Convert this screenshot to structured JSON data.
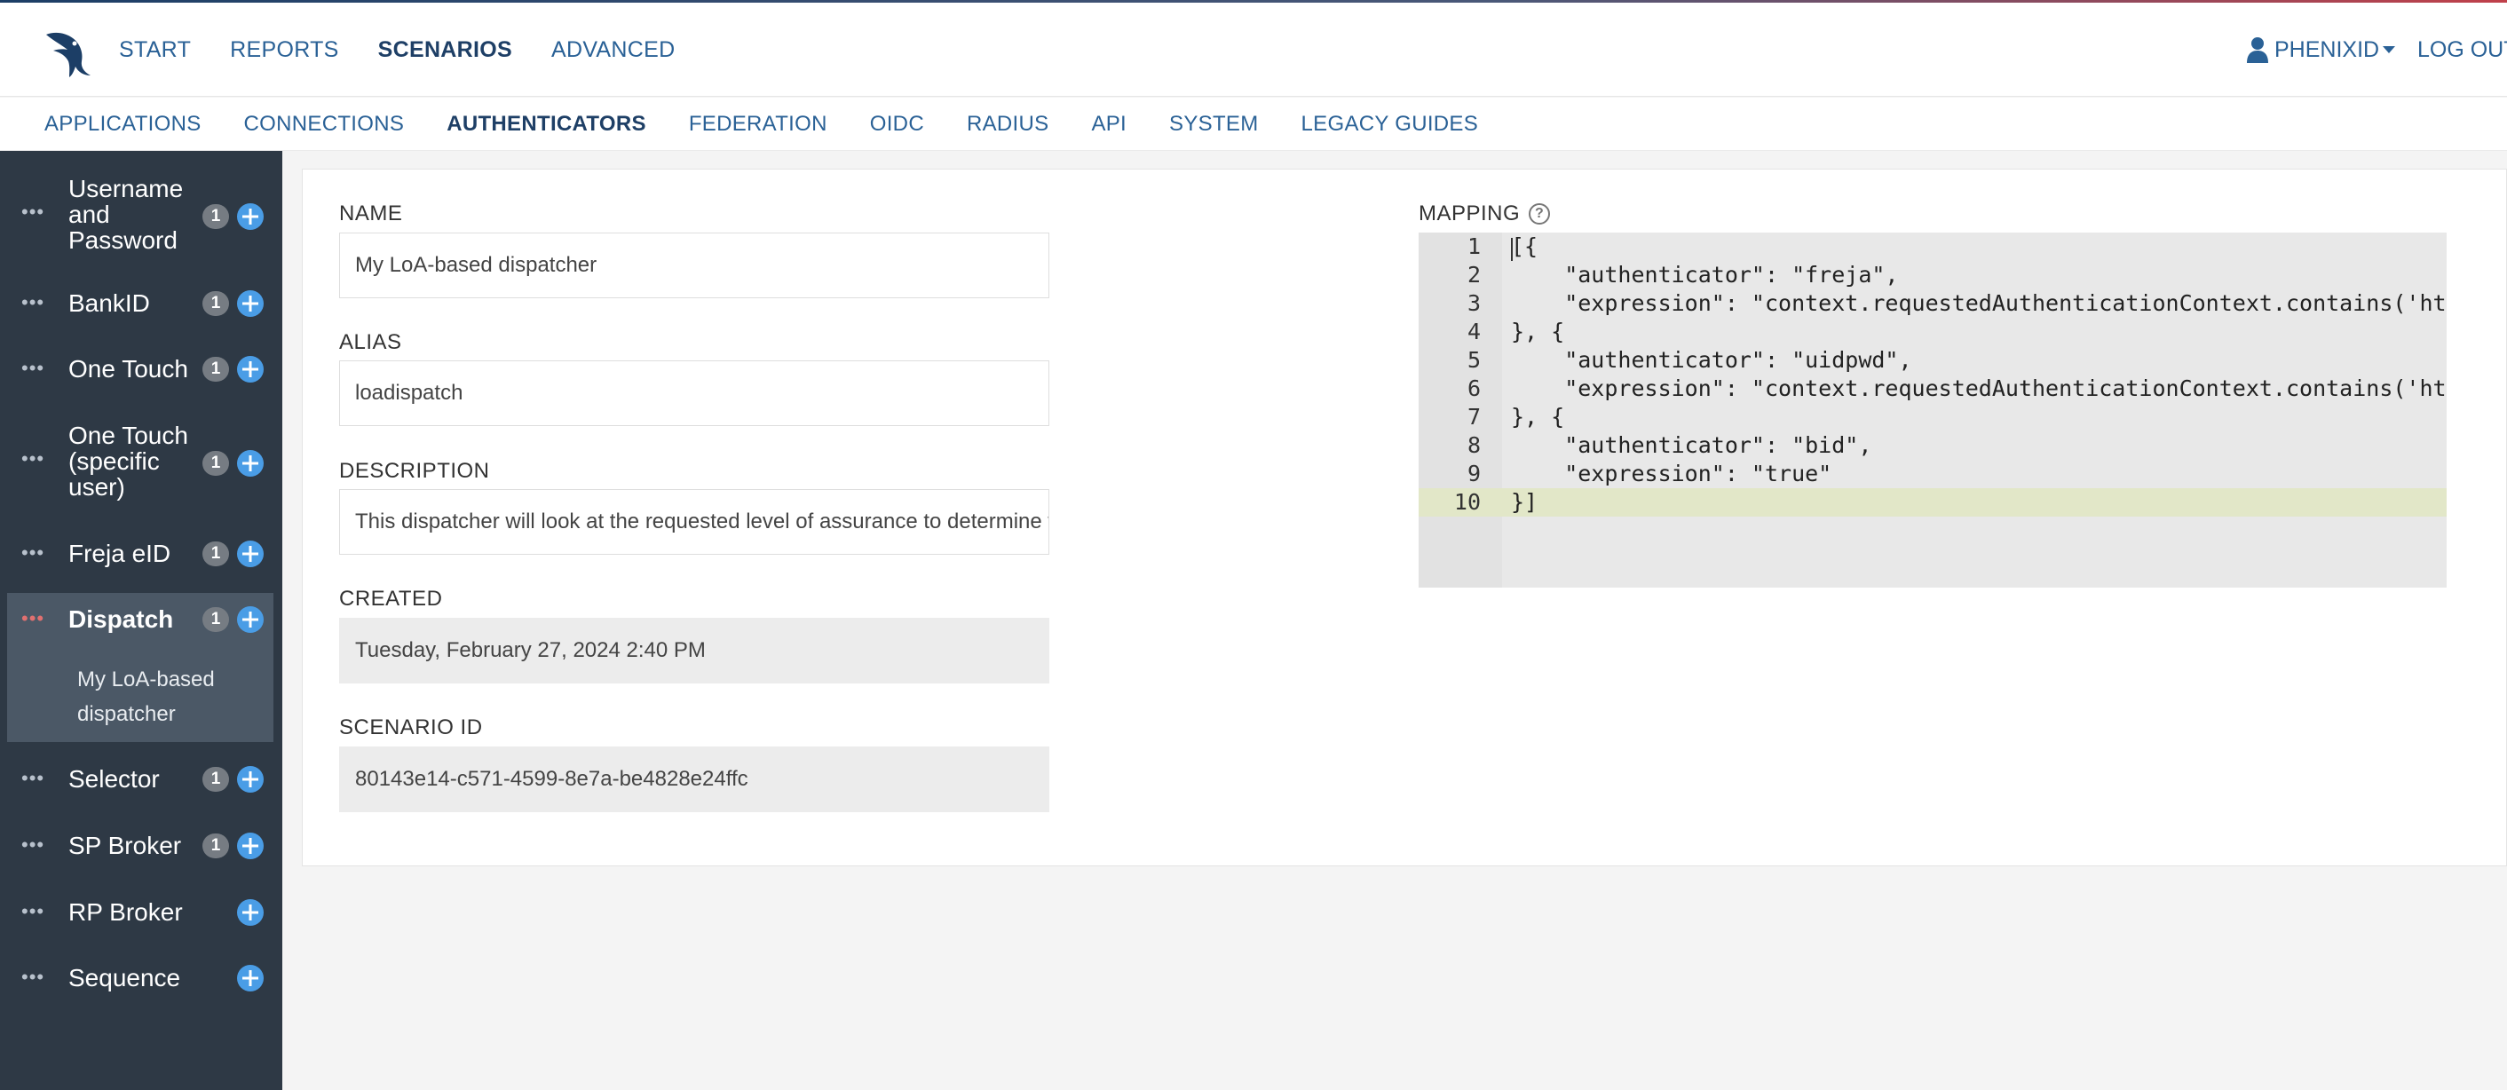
{
  "nav": {
    "links": [
      "START",
      "REPORTS",
      "SCENARIOS",
      "ADVANCED"
    ],
    "active": "SCENARIOS",
    "user": "PHENIXID",
    "logout": "LOG OUT"
  },
  "subnav": {
    "links": [
      "APPLICATIONS",
      "CONNECTIONS",
      "AUTHENTICATORS",
      "FEDERATION",
      "OIDC",
      "RADIUS",
      "API",
      "SYSTEM",
      "LEGACY GUIDES"
    ],
    "active": "AUTHENTICATORS"
  },
  "sidebar": {
    "items": [
      {
        "label": "Username and Password",
        "count": "1"
      },
      {
        "label": "BankID",
        "count": "1"
      },
      {
        "label": "One Touch",
        "count": "1"
      },
      {
        "label": "One Touch (specific user)",
        "count": "1"
      },
      {
        "label": "Freja eID",
        "count": "1"
      },
      {
        "label": "Dispatch",
        "count": "1",
        "active": true,
        "child": "My LoA-based dispatcher"
      },
      {
        "label": "Selector",
        "count": "1"
      },
      {
        "label": "SP Broker",
        "count": "1"
      },
      {
        "label": "RP Broker",
        "count": ""
      },
      {
        "label": "Sequence",
        "count": ""
      }
    ]
  },
  "form": {
    "name_label": "NAME",
    "name_value": "My LoA-based dispatcher",
    "alias_label": "ALIAS",
    "alias_value": "loadispatch",
    "description_label": "DESCRIPTION",
    "description_value": "This dispatcher will look at the requested level of assurance to determine which authenticator to use",
    "created_label": "CREATED",
    "created_value": "Tuesday, February 27, 2024 2:40 PM",
    "scenario_id_label": "SCENARIO ID",
    "scenario_id_value": "80143e14-c571-4599-8e7a-be4828e24ffc"
  },
  "mapping": {
    "label": "MAPPING",
    "help_icon": "?",
    "lines": [
      "[{",
      "    \"authenticator\": \"freja\",",
      "    \"expression\": \"context.requestedAuthenticationContext.contains('http://",
      "}, {",
      "    \"authenticator\": \"uidpwd\",",
      "    \"expression\": \"context.requestedAuthenticationContext.contains('http://",
      "}, {",
      "    \"authenticator\": \"bid\",",
      "    \"expression\": \"true\"",
      "}]"
    ],
    "active_line": 10
  }
}
